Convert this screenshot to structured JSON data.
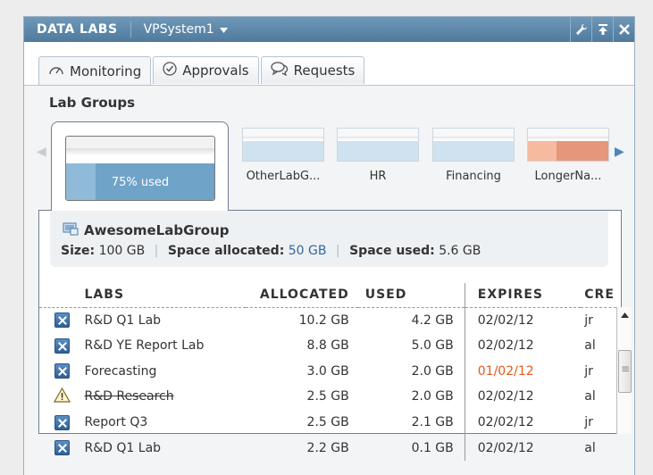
{
  "window": {
    "app_title": "DATA LABS",
    "system_name": "VPSystem1"
  },
  "tabs": [
    {
      "label": "Monitoring",
      "icon": "gauge-icon",
      "active": true
    },
    {
      "label": "Approvals",
      "icon": "check-circle-icon",
      "active": false
    },
    {
      "label": "Requests",
      "icon": "speech-bubbles-icon",
      "active": false
    }
  ],
  "lab_groups": {
    "title": "Lab Groups",
    "selected": {
      "label": "75% used",
      "used_fraction": 0.75
    },
    "groups": [
      {
        "label": "OtherLabG..."
      },
      {
        "label": "HR"
      },
      {
        "label": "Financing"
      },
      {
        "label": "LongerNa..."
      }
    ]
  },
  "details": {
    "name": "AwesomeLabGroup",
    "size_label": "Size",
    "size_value": "100 GB",
    "allocated_label": "Space allocated",
    "allocated_value": "50 GB",
    "used_label": "Space used",
    "used_value": "5.6 GB"
  },
  "table": {
    "headers": [
      "LABS",
      "ALLOCATED",
      "USED",
      "EXPIRES",
      "CRE"
    ],
    "rows": [
      {
        "status": "x",
        "lab": "R&D Q1 Lab",
        "allocated": "10.2 GB",
        "used": "4.2 GB",
        "expires": "02/02/12",
        "creator": "jr"
      },
      {
        "status": "x",
        "lab": "R&D YE Report Lab",
        "allocated": "8.8 GB",
        "used": "5.0 GB",
        "expires": "02/02/12",
        "creator": "al"
      },
      {
        "status": "x",
        "lab": "Forecasting",
        "allocated": "3.0 GB",
        "used": "2.0 GB",
        "expires": "01/02/12",
        "creator": "jr"
      },
      {
        "status": "warn",
        "lab": "R&D Research",
        "allocated": "2.5 GB",
        "used": "2.0 GB",
        "expires": "02/02/12",
        "creator": "al"
      },
      {
        "status": "x",
        "lab": "Report Q3",
        "allocated": "2.5 GB",
        "used": "2.1 GB",
        "expires": "02/02/12",
        "creator": "jr"
      },
      {
        "status": "x",
        "lab": "R&D Q1 Lab",
        "allocated": "2.2 GB",
        "used": "0.1 GB",
        "expires": "02/02/12",
        "creator": "al"
      }
    ]
  },
  "colors": {
    "titlebar": "#5a85a8",
    "accent_blue": "#6fa3c8",
    "expired_red": "#e25a1c",
    "group_orange": "#e6967a"
  }
}
